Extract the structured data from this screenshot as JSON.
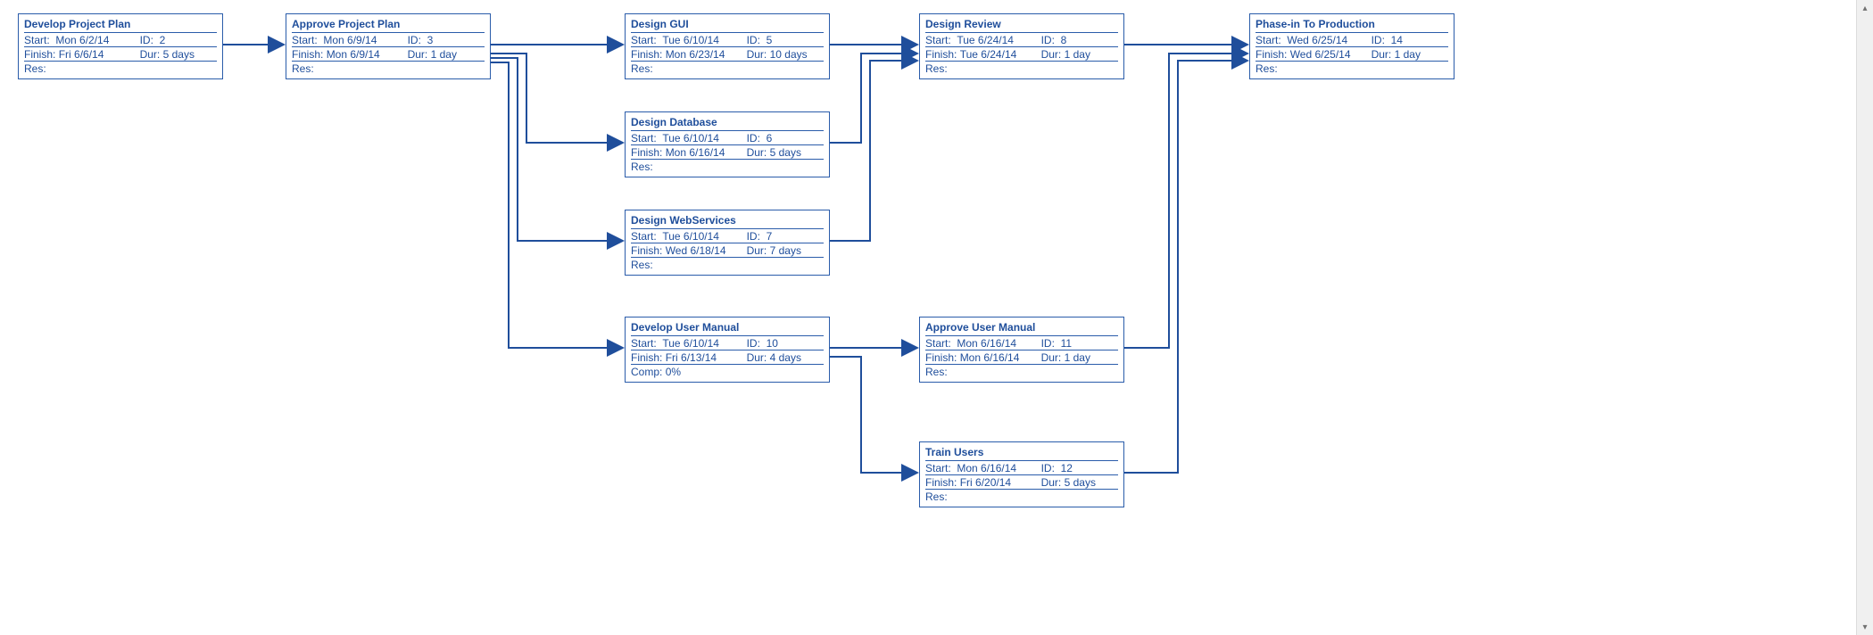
{
  "labels": {
    "start": "Start:",
    "finish": "Finish:",
    "id": "ID:",
    "dur": "Dur:",
    "res": "Res:",
    "comp": "Comp:"
  },
  "nodes": {
    "develop_project_plan": {
      "title": "Develop Project Plan",
      "start": "Mon 6/2/14",
      "id": "2",
      "finish": "Fri 6/6/14",
      "dur": "5 days",
      "res": ""
    },
    "approve_project_plan": {
      "title": "Approve Project Plan",
      "start": "Mon 6/9/14",
      "id": "3",
      "finish": "Mon 6/9/14",
      "dur": "1 day",
      "res": ""
    },
    "design_gui": {
      "title": "Design GUI",
      "start": "Tue 6/10/14",
      "id": "5",
      "finish": "Mon 6/23/14",
      "dur": "10 days",
      "res": ""
    },
    "design_database": {
      "title": "Design Database",
      "start": "Tue 6/10/14",
      "id": "6",
      "finish": "Mon 6/16/14",
      "dur": "5 days",
      "res": ""
    },
    "design_webservices": {
      "title": "Design WebServices",
      "start": "Tue 6/10/14",
      "id": "7",
      "finish": "Wed 6/18/14",
      "dur": "7 days",
      "res": ""
    },
    "develop_user_manual": {
      "title": "Develop User Manual",
      "start": "Tue 6/10/14",
      "id": "10",
      "finish": "Fri 6/13/14",
      "dur": "4 days",
      "comp": "0%"
    },
    "design_review": {
      "title": "Design Review",
      "start": "Tue 6/24/14",
      "id": "8",
      "finish": "Tue 6/24/14",
      "dur": "1 day",
      "res": ""
    },
    "approve_user_manual": {
      "title": "Approve User Manual",
      "start": "Mon 6/16/14",
      "id": "11",
      "finish": "Mon 6/16/14",
      "dur": "1 day",
      "res": ""
    },
    "train_users": {
      "title": "Train Users",
      "start": "Mon 6/16/14",
      "id": "12",
      "finish": "Fri 6/20/14",
      "dur": "5 days",
      "res": ""
    },
    "phase_in_production": {
      "title": "Phase-in To Production",
      "start": "Wed 6/25/14",
      "id": "14",
      "finish": "Wed 6/25/14",
      "dur": "1 day",
      "res": ""
    }
  },
  "colors": {
    "border": "#2a5caa",
    "text": "#1f4e9b"
  }
}
